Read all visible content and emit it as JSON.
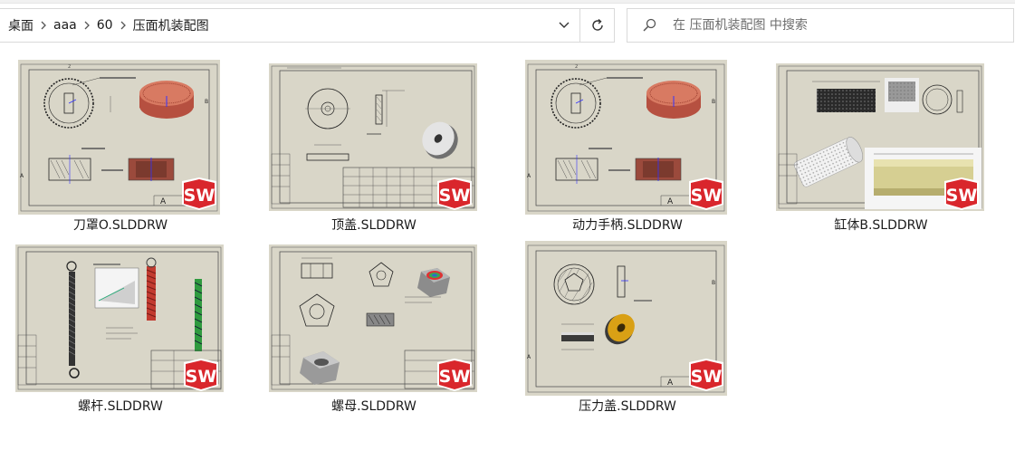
{
  "breadcrumb": [
    "桌面",
    "aaa",
    "60",
    "压面机装配图"
  ],
  "search": {
    "placeholder": "在 压面机装配图 中搜索"
  },
  "icons": {
    "dropdown": "chevron-down-icon",
    "refresh": "refresh-icon",
    "search": "search-icon",
    "sep": "chevron-right-icon",
    "badge": "solidworks-icon"
  },
  "files": [
    {
      "name": "刀罩O.SLDDRW"
    },
    {
      "name": "顶盖.SLDDRW"
    },
    {
      "name": "动力手柄.SLDDRW"
    },
    {
      "name": "缸体B.SLDDRW"
    },
    {
      "name": "螺杆.SLDDRW"
    },
    {
      "name": "螺母.SLDDRW"
    },
    {
      "name": "压力盖.SLDDRW"
    }
  ],
  "colors": {
    "sheet_bg": "#d9d6c8",
    "badge_red": "#d9262c"
  }
}
